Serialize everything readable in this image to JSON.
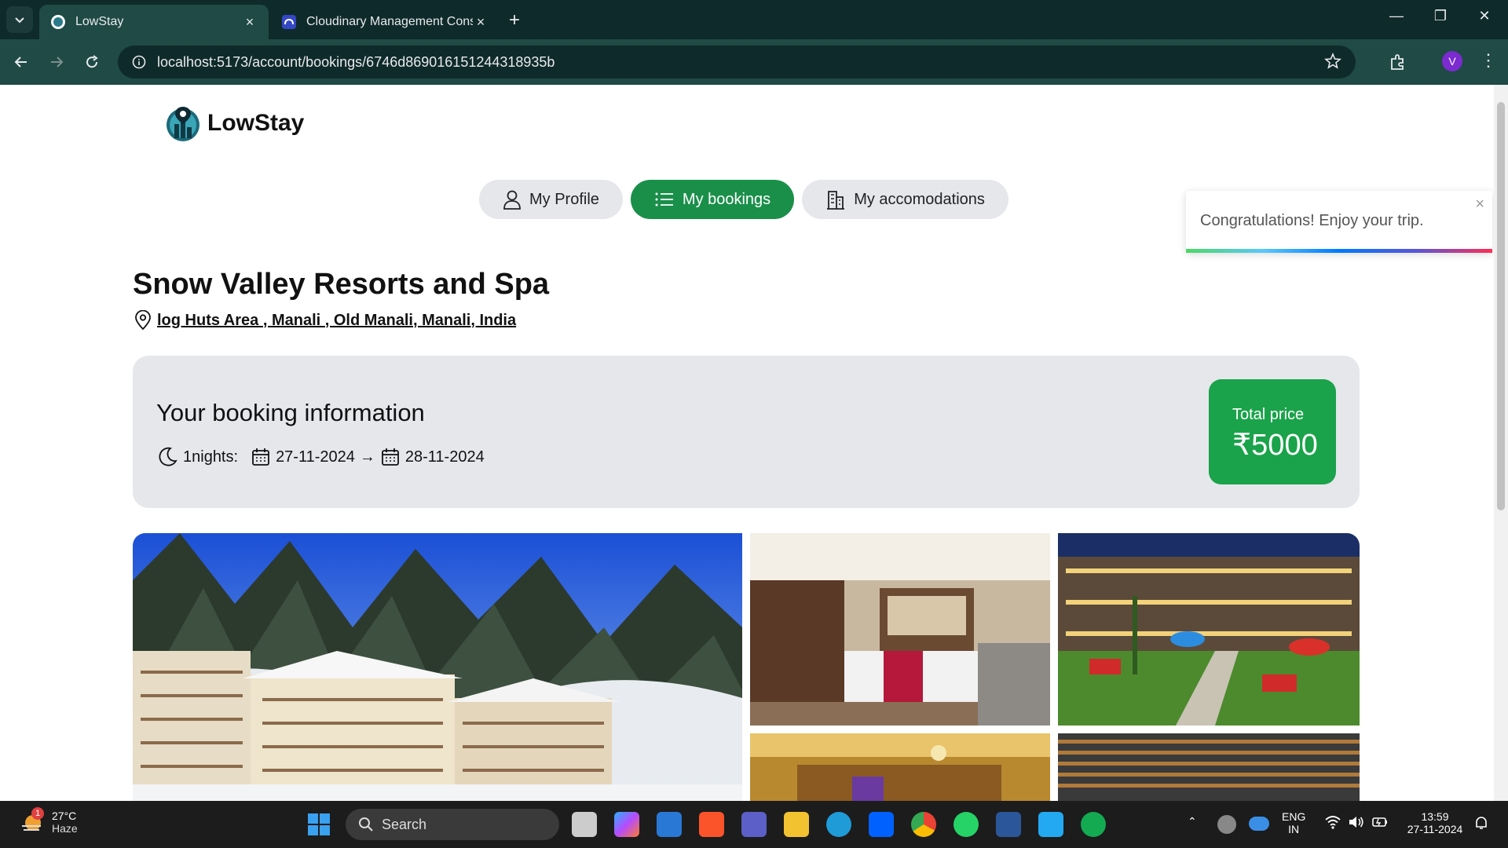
{
  "browser": {
    "tabs": [
      {
        "title": "LowStay"
      },
      {
        "title": "Cloudinary Management Conso"
      }
    ],
    "url": "localhost:5173/account/bookings/6746d8690161512443189 35b",
    "url_display": "localhost:5173/account/bookings/6746d86901615124431893 5b",
    "address": "localhost:5173/account/bookings/6746d869016151244318935b",
    "profile_initial": "V"
  },
  "header": {
    "brand": "LowStay"
  },
  "nav": {
    "profile": "My Profile",
    "bookings": "My bookings",
    "accommodations": "My accomodations"
  },
  "place": {
    "title": "Snow Valley Resorts and Spa",
    "address": "log Huts Area , Manali , Old Manali, Manali, India"
  },
  "booking": {
    "heading": "Your booking information",
    "nights": "1nights:",
    "check_in": "27-11-2024",
    "arrow": "→",
    "check_out": "28-11-2024",
    "price_label": "Total price",
    "price_value": "₹5000"
  },
  "toast": {
    "message": "Congratulations! Enjoy your trip.",
    "close": "×"
  },
  "taskbar": {
    "temp": "27°C",
    "weather": "Haze",
    "notification_count": "1",
    "search": "Search",
    "lang1": "ENG",
    "lang2": "IN",
    "time": "13:59",
    "date": "27-11-2024"
  },
  "colors": {
    "accent_green": "#1a8f4a",
    "price_green": "#1aa34a",
    "chrome_dark": "#0f2a2a",
    "chrome_bar": "#1f4a45"
  }
}
